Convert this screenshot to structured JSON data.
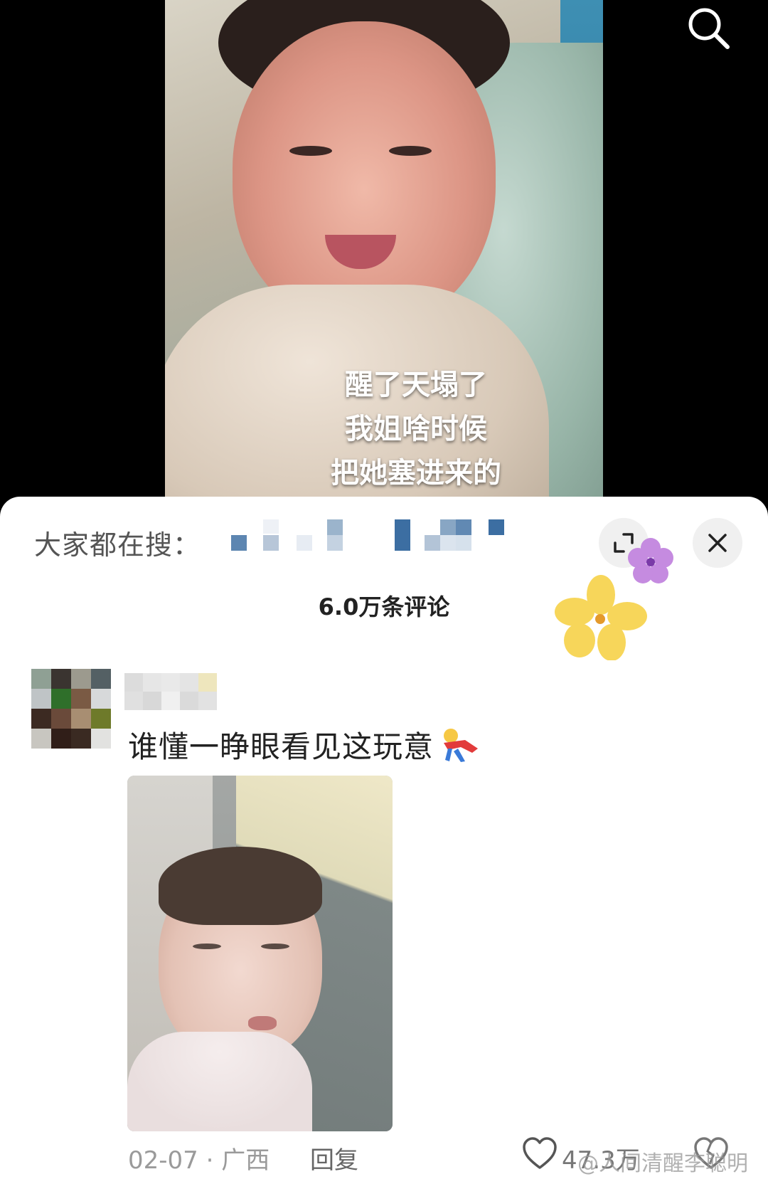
{
  "video": {
    "caption_lines": [
      "醒了天塌了",
      "我姐啥时候",
      "把她塞进来的"
    ]
  },
  "header": {
    "search_icon": "search-icon"
  },
  "sheet": {
    "search_label": "大家都在搜：",
    "expand_icon": "expand-icon",
    "close_icon": "close-icon",
    "comment_count": "6.0万条评论"
  },
  "comment": {
    "text": "谁懂一睁眼看见这玩意",
    "emoji": "falling-figure-emoji",
    "date_location": "02-07 · 广西",
    "reply_label": "回复",
    "like_count": "47.3万",
    "like_icon": "heart-icon",
    "dislike_icon": "broken-heart-icon"
  },
  "watermark": "@人间清醒李聪明",
  "colors": {
    "sheet_bg": "#ffffff",
    "text_primary": "#222222",
    "text_secondary": "#9a9a9a",
    "button_bg": "#f0f0f0"
  }
}
